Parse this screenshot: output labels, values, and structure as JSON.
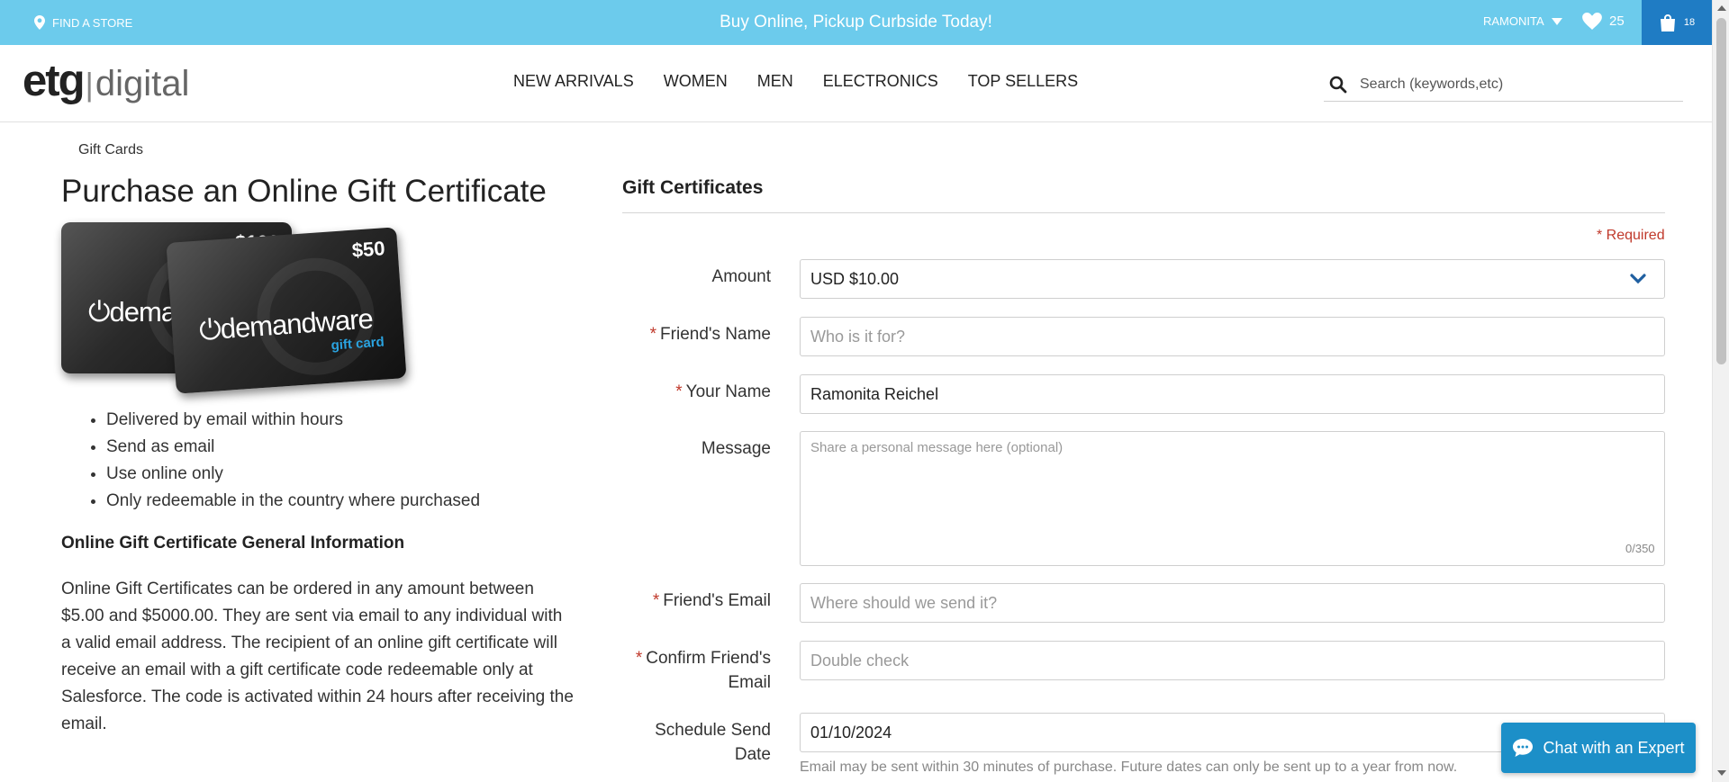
{
  "topbar": {
    "find_store": "FIND A STORE",
    "promo": "Buy Online, Pickup Curbside Today!",
    "user": "RAMONITA",
    "wishlist_count": "25",
    "cart_count": "18"
  },
  "header": {
    "logo_left": "etg",
    "logo_right": "digital",
    "nav": [
      "NEW ARRIVALS",
      "WOMEN",
      "MEN",
      "ELECTRONICS",
      "TOP SELLERS"
    ],
    "search_placeholder": "Search (keywords,etc)"
  },
  "left": {
    "breadcrumb": "Gift Cards",
    "title": "Purchase an Online Gift Certificate",
    "card_front": {
      "amount": "$50",
      "brand": "demandware",
      "sub": "gift card"
    },
    "card_back": {
      "amount": "$100",
      "brand": "demandware"
    },
    "bullets": [
      "Delivered by email within hours",
      "Send as email",
      "Use online only",
      "Only redeemable in the country where purchased"
    ],
    "info_heading": "Online Gift Certificate General Information",
    "info_text": "Online Gift Certificates can be ordered in any amount between $5.00 and $5000.00. They are sent via email to any individual with a valid email address. The recipient of an online gift certificate will receive an email with a gift certificate code redeemable only at Salesforce. The code is activated within 24 hours after receiving the email."
  },
  "form": {
    "heading": "Gift Certificates",
    "required_note": "Required",
    "amount_label": "Amount",
    "amount_value": "USD $10.00",
    "friend_name_label": "Friend's Name",
    "friend_name_placeholder": "Who is it for?",
    "your_name_label": "Your Name",
    "your_name_value": "Ramonita Reichel",
    "message_label": "Message",
    "message_placeholder": "Share a personal message here (optional)",
    "message_counter": "0/350",
    "friend_email_label": "Friend's Email",
    "friend_email_placeholder": "Where should we send it?",
    "confirm_email_label_1": "Confirm Friend's",
    "confirm_email_label_2": "Email",
    "confirm_email_placeholder": "Double check",
    "send_date_label_1": "Schedule Send",
    "send_date_label_2": "Date",
    "send_date_value": "01/10/2024",
    "send_date_hint": "Email may be sent within 30 minutes of purchase. Future dates can only be sent up to a year from now."
  },
  "chat": {
    "label": "Chat with an Expert"
  }
}
